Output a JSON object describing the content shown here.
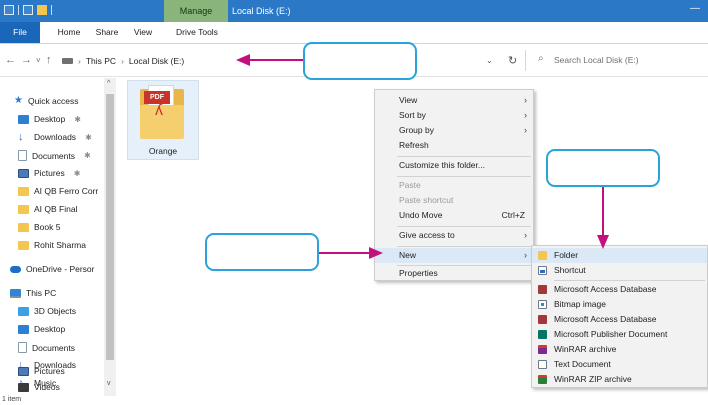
{
  "titlebar": {
    "manage_tab": "Manage",
    "title": "Local Disk (E:)",
    "minimize": "—"
  },
  "ribbon": {
    "tabs": [
      "File",
      "Home",
      "Share",
      "View",
      "Drive Tools"
    ]
  },
  "addressbar": {
    "back": "←",
    "forward": "→",
    "recent": "˅",
    "up": "↑",
    "path": [
      "This PC",
      "Local Disk (E:)"
    ],
    "path_sep": "›",
    "dropdown": "⌄",
    "refresh": "↻",
    "search_icon": "⌕",
    "search_placeholder": "Search Local Disk (E:)"
  },
  "nav_pane": {
    "items": [
      {
        "label": "Quick access",
        "icon": "star-icon"
      },
      {
        "label": "Desktop",
        "icon": "desktop-icon",
        "pinned": true
      },
      {
        "label": "Downloads",
        "icon": "download-icon",
        "pinned": true
      },
      {
        "label": "Documents",
        "icon": "document-icon",
        "pinned": true
      },
      {
        "label": "Pictures",
        "icon": "pictures-icon",
        "pinned": true
      },
      {
        "label": "AI QB Ferro Corr",
        "icon": "folder-icon"
      },
      {
        "label": "AI QB Final",
        "icon": "folder-icon"
      },
      {
        "label": "Book 5",
        "icon": "folder-icon"
      },
      {
        "label": "Rohit Sharma",
        "icon": "folder-icon"
      },
      {
        "label": "OneDrive - Persor",
        "icon": "cloud-icon"
      },
      {
        "label": "This PC",
        "icon": "computer-icon"
      },
      {
        "label": "3D Objects",
        "icon": "cube-icon"
      },
      {
        "label": "Desktop",
        "icon": "desktop-icon"
      },
      {
        "label": "Documents",
        "icon": "document-icon"
      },
      {
        "label": "Downloads",
        "icon": "download-icon"
      },
      {
        "label": "Music",
        "icon": "music-icon"
      },
      {
        "label": "Pictures",
        "icon": "pictures-icon"
      },
      {
        "label": "Videos",
        "icon": "video-icon"
      }
    ],
    "pin_glyph": "✱",
    "scroll_up": "^",
    "scroll_down": "v"
  },
  "status": {
    "text": "1 item"
  },
  "file": {
    "name": "Orange",
    "badge": "PDF",
    "glyph": "ʎ"
  },
  "context_menu": {
    "items": [
      {
        "label": "View",
        "arrow": "›"
      },
      {
        "label": "Sort by",
        "arrow": "›"
      },
      {
        "label": "Group by",
        "arrow": "›"
      },
      {
        "label": "Refresh"
      },
      {
        "label": "Customize this folder..."
      },
      {
        "label": "Paste"
      },
      {
        "label": "Paste shortcut"
      },
      {
        "label": "Undo Move",
        "shortcut": "Ctrl+Z"
      },
      {
        "label": "Give access to",
        "arrow": "›"
      },
      {
        "label": "New",
        "arrow": "›"
      },
      {
        "label": "Properties"
      }
    ]
  },
  "new_submenu": {
    "items": [
      {
        "label": "Folder",
        "icon": "folder-icon"
      },
      {
        "label": "Shortcut",
        "icon": "shortcut-icon"
      },
      {
        "label": "Microsoft Access Database",
        "icon": "access-icon"
      },
      {
        "label": "Bitmap image",
        "icon": "bitmap-icon"
      },
      {
        "label": "Microsoft Access Database",
        "icon": "access-icon"
      },
      {
        "label": "Microsoft Publisher Document",
        "icon": "publisher-icon"
      },
      {
        "label": "WinRAR archive",
        "icon": "winrar-icon"
      },
      {
        "label": "Text Document",
        "icon": "text-document-icon"
      },
      {
        "label": "WinRAR ZIP archive",
        "icon": "winrar-zip-icon"
      }
    ]
  },
  "colors": {
    "titlebar": "#2b78c7",
    "manage_tab": "#8ab57a",
    "callout_border": "#2aa3dc",
    "arrow": "#c4107f"
  }
}
